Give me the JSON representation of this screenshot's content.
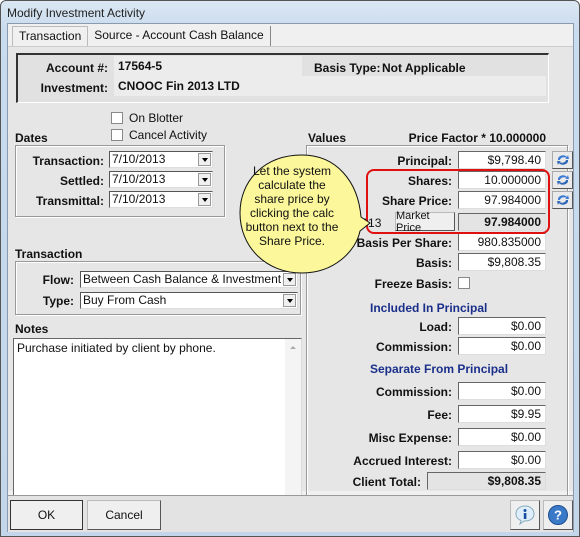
{
  "window": {
    "title": "Modify Investment Activity"
  },
  "tabs": [
    {
      "label": "Transaction",
      "active": true
    },
    {
      "label": "Source - Account Cash Balance",
      "active": false
    }
  ],
  "header": {
    "account_label": "Account #:",
    "account_value": "17564-5",
    "investment_label": "Investment:",
    "investment_value": "CNOOC Fin 2013 LTD",
    "basis_type_label": "Basis Type:",
    "basis_type_value": "Not Applicable"
  },
  "checkboxes": {
    "on_blotter": {
      "label": "On Blotter",
      "checked": false
    },
    "cancel_activity": {
      "label": "Cancel Activity",
      "checked": false
    }
  },
  "dates": {
    "title": "Dates",
    "transaction_label": "Transaction:",
    "transaction_value": "7/10/2013",
    "settled_label": "Settled:",
    "settled_value": "7/10/2013",
    "transmittal_label": "Transmittal:",
    "transmittal_value": "7/10/2013"
  },
  "transaction": {
    "title": "Transaction",
    "flow_label": "Flow:",
    "flow_value": "Between Cash Balance & Investment",
    "type_label": "Type:",
    "type_value": "Buy From Cash"
  },
  "notes": {
    "title": "Notes",
    "value": "Purchase initiated by client by phone."
  },
  "values": {
    "title": "Values",
    "price_factor": "Price Factor * 10.000000",
    "principal_label": "Principal:",
    "principal_value": "$9,798.40",
    "shares_label": "Shares:",
    "shares_value": "10.000000",
    "share_price_label": "Share Price:",
    "share_price_value": "97.984000",
    "market_date": "7/10/2013",
    "market_price_button": "Market Price",
    "market_price_value": "97.984000",
    "basis_per_share_label": "Basis Per Share:",
    "basis_per_share_value": "980.835000",
    "basis_label": "Basis:",
    "basis_value": "$9,808.35",
    "freeze_basis_label": "Freeze Basis:",
    "freeze_basis_checked": false,
    "included_title": "Included In Principal",
    "load_label": "Load:",
    "load_value": "$0.00",
    "inc_commission_label": "Commission:",
    "inc_commission_value": "$0.00",
    "separate_title": "Separate From Principal",
    "sep_commission_label": "Commission:",
    "sep_commission_value": "$0.00",
    "fee_label": "Fee:",
    "fee_value": "$9.95",
    "misc_expense_label": "Misc Expense:",
    "misc_expense_value": "$0.00",
    "accrued_interest_label": "Accrued Interest:",
    "accrued_interest_value": "$0.00",
    "client_total_label": "Client Total:",
    "client_total_value": "$9,808.35"
  },
  "callout": {
    "text": "Let the system calculate the share price by clicking the calc button next to the Share Price."
  },
  "footer": {
    "ok_label": "OK",
    "cancel_label": "Cancel"
  },
  "colors": {
    "highlight": "#e01010",
    "callout_fill": "#fbf79a",
    "subheading": "#1a2f8a"
  }
}
